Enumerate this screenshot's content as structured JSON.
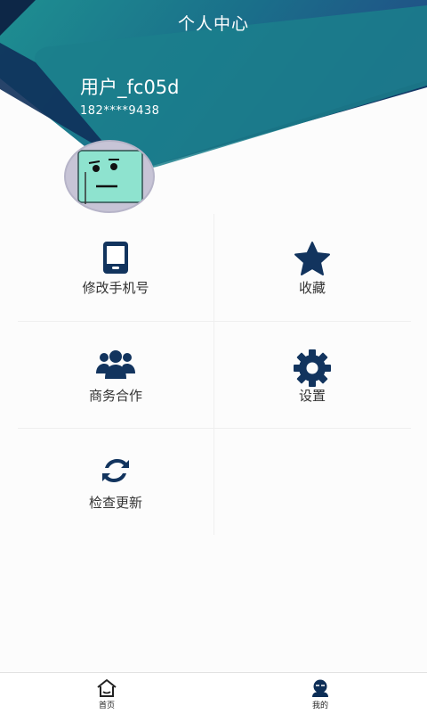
{
  "header": {
    "title": "个人中心",
    "username": "用户_fc05d",
    "phone": "182****9438"
  },
  "menu": [
    {
      "label": "修改手机号",
      "icon": "phone-icon"
    },
    {
      "label": "收藏",
      "icon": "star-icon"
    },
    {
      "label": "商务合作",
      "icon": "users-icon"
    },
    {
      "label": "设置",
      "icon": "gear-icon"
    },
    {
      "label": "检查更新",
      "icon": "refresh-icon"
    }
  ],
  "tabbar": {
    "home": {
      "label": "首页",
      "icon": "home-icon"
    },
    "mine": {
      "label": "我的",
      "icon": "user-icon"
    }
  },
  "colors": {
    "accent": "#0d2e57",
    "teal": "#1a8a8e",
    "navy": "#0f2a50",
    "icon": "#12345e"
  }
}
